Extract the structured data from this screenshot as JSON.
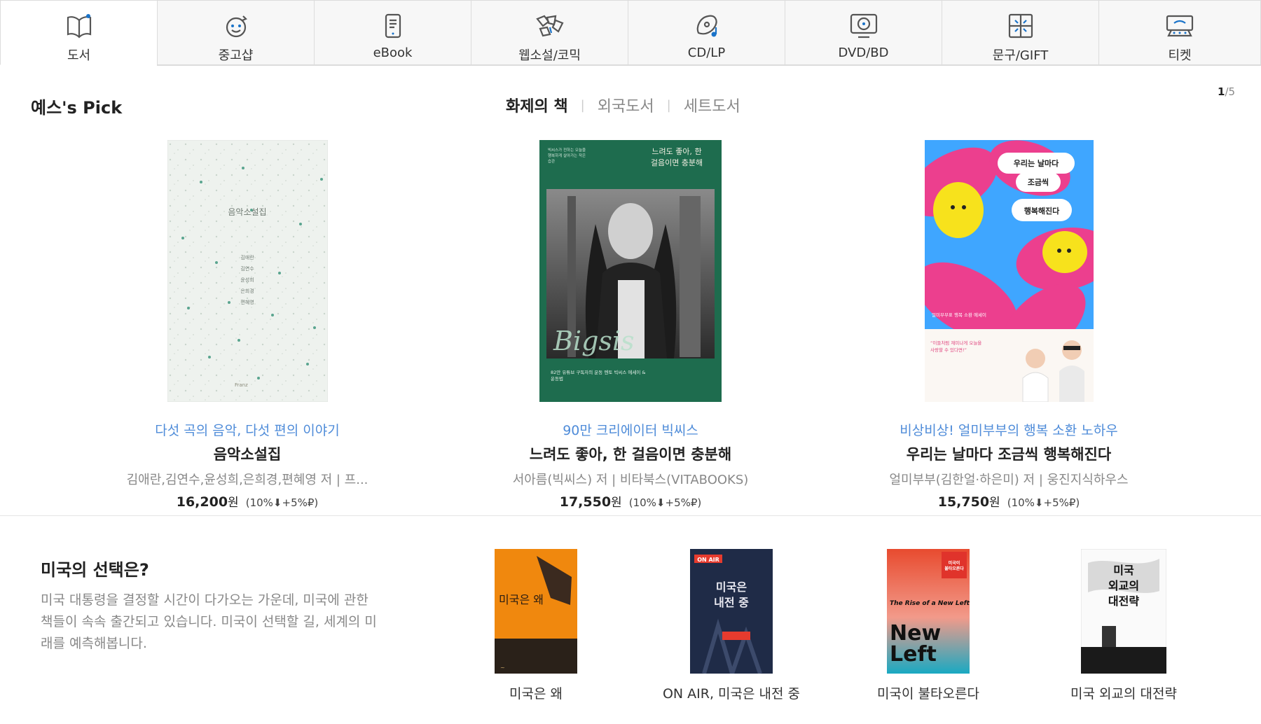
{
  "nav": {
    "items": [
      {
        "label": "도서",
        "icon": "book-icon",
        "active": true
      },
      {
        "label": "중고샵",
        "icon": "used-shop-icon"
      },
      {
        "label": "eBook",
        "icon": "ebook-icon"
      },
      {
        "label": "웹소설/코믹",
        "icon": "comic-icon"
      },
      {
        "label": "CD/LP",
        "icon": "music-icon"
      },
      {
        "label": "DVD/BD",
        "icon": "dvd-icon"
      },
      {
        "label": "문구/GIFT",
        "icon": "gift-icon"
      },
      {
        "label": "티켓",
        "icon": "ticket-icon"
      }
    ]
  },
  "pick": {
    "title": "예스's Pick",
    "tabs": [
      "화제의 책",
      "외국도서",
      "세트도서"
    ],
    "active_tab": "화제의 책",
    "pager": {
      "current": "1",
      "total": "/5"
    },
    "books": [
      {
        "subtitle": "다섯 곡의 음악, 다섯 편의 이야기",
        "title": "음악소설집",
        "author": "김애란,김연수,윤성희,은희경,편혜영 저 | 프...",
        "price": "16,200",
        "won": "원",
        "discount": "(10%⬇+5%₽)",
        "cover": {
          "title": "음악소설집",
          "authors": [
            "김애란",
            "김연수",
            "윤성희",
            "은희경",
            "편혜영"
          ],
          "publisher": "Franz"
        }
      },
      {
        "subtitle": "90만 크리에이터 빅씨스",
        "title": "느려도 좋아, 한 걸음이면 충분해",
        "author": "서아름(빅씨스) 저 | 비타북스(VITABOOKS)",
        "price": "17,550",
        "won": "원",
        "discount": "(10%⬇+5%₽)",
        "cover": {
          "kicker": "빅씨스가 전하는 오늘을 행복하게 살아가는 작은 습관",
          "title": "느려도 좋아, 한 걸음이면 충분해",
          "script": "Bigsis",
          "bottom": "82만 유튜브 구독자의 운동 멘토 빅씨스 에세이 & 운동법"
        }
      },
      {
        "subtitle": "비상비상! 얼미부부의 행복 소환 노하우",
        "title": "우리는 날마다 조금씩 행복해진다",
        "author": "얼미부부(김한얼·하은미) 저 | 웅진지식하우스",
        "price": "15,750",
        "won": "원",
        "discount": "(10%⬇+5%₽)",
        "cover": {
          "line1": "우리는 날마다",
          "line2": "조금씩",
          "line3": "행복해진다",
          "quote": "“이들처럼 재미나게 오늘을 사랑할 수 있다면!”",
          "series": "얼미부부표 행복 소환 에세이"
        }
      }
    ]
  },
  "us": {
    "title": "미국의 선택은?",
    "desc": "미국 대통령을 결정할 시간이 다가오는 가운데, 미국에 관한 책들이 속속 출간되고 있습니다. 미국이 선택할 길, 세계의 미래를 예측해봅니다.",
    "books": [
      {
        "label": "미국은 왜",
        "cover_text": "미국은 왜"
      },
      {
        "label": "ON AIR, 미국은 내전 중",
        "cover_badge": "ON AIR",
        "cover_text": "미국은 내전 중"
      },
      {
        "label": "미국이 불타오른다",
        "cover_text": "The Rise of a New Left",
        "cover_badge": "미국이 불타오른다"
      },
      {
        "label": "미국 외교의 대전략",
        "cover_text": "미국 외교의 대전략"
      }
    ]
  },
  "colors": {
    "accent_blue": "#4f8cd9",
    "icon_blue": "#1a73c9"
  }
}
